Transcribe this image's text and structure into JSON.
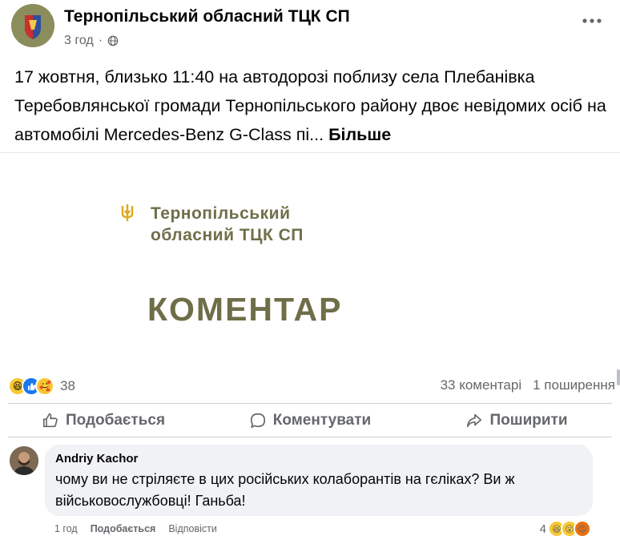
{
  "header": {
    "page_name": "Тернопільський обласний ТЦК СП",
    "time": "3 год",
    "more_label": "···"
  },
  "post": {
    "text": "17 жовтня, близько 11:40 на автодорозі поблизу села Плебанівка Теребовлянської громади Тернопільського району двоє невідомих осіб на автомобілі Mercedes-Benz G-Class пі...",
    "see_more": "Більше"
  },
  "image": {
    "line1": "Тернопільський",
    "line2": "обласний ТЦК СП",
    "title": "КОМЕНТАР"
  },
  "stats": {
    "reaction_count": "38",
    "comments": "33 коментарі",
    "shares": "1 поширення",
    "reactions": [
      "haha",
      "like",
      "care"
    ]
  },
  "actions": {
    "like": "Подобається",
    "comment": "Коментувати",
    "share": "Поширити"
  },
  "comment": {
    "author": "Andriy Kachor",
    "text": "чому ви не стріляєте в цих російських колаборантів на гєліках? Ви ж військовослужбовці! Ганьба!",
    "time": "1 год",
    "like_label": "Подобається",
    "reply_label": "Відповісти",
    "reaction_count": "4",
    "reactions": [
      "haha",
      "wow",
      "angry"
    ]
  },
  "colors": {
    "brand_olive": "#6e6e48",
    "like_blue": "#1877f2",
    "secondary_text": "#65676b"
  }
}
